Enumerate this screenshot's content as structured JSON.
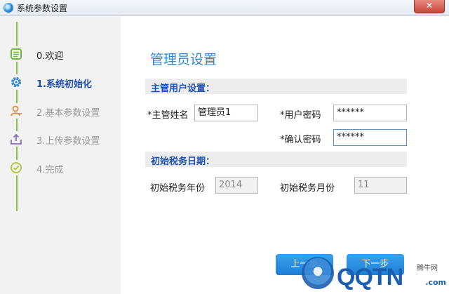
{
  "window": {
    "title": "系统参数设置",
    "close_label": "✕"
  },
  "sidebar": {
    "steps": [
      {
        "label": "0.欢迎",
        "state": "done",
        "icon": "list-icon"
      },
      {
        "label": "1.系统初始化",
        "state": "active",
        "icon": "gear-icon"
      },
      {
        "label": "2.基本参数设置",
        "state": "pending",
        "icon": "user-icon"
      },
      {
        "label": "3.上传参数设置",
        "state": "pending",
        "icon": "upload-icon"
      },
      {
        "label": "4.完成",
        "state": "pending",
        "icon": "check-circle-icon"
      }
    ]
  },
  "main": {
    "heading": "管理员设置",
    "admin_section": {
      "title": "主管用户设置：",
      "name_label": "*主管姓名",
      "name_value": "管理员1",
      "password_label": "*用户密码",
      "password_value": "******",
      "confirm_label": "*确认密码",
      "confirm_value": "******"
    },
    "tax_section": {
      "title": "初始税务日期：",
      "year_label": "初始税务年份",
      "year_value": "2014",
      "month_label": "初始税务月份",
      "month_value": "11"
    }
  },
  "buttons": {
    "prev": "上一步",
    "next": "下一步"
  },
  "watermark": {
    "brand": "QQTN",
    "small": "腾牛网",
    "domain": ".com"
  },
  "colors": {
    "accent": "#2e86d1",
    "active_step": "#1f4fb4",
    "timeline": "#8cc63f",
    "button": "#2b8fe3"
  }
}
